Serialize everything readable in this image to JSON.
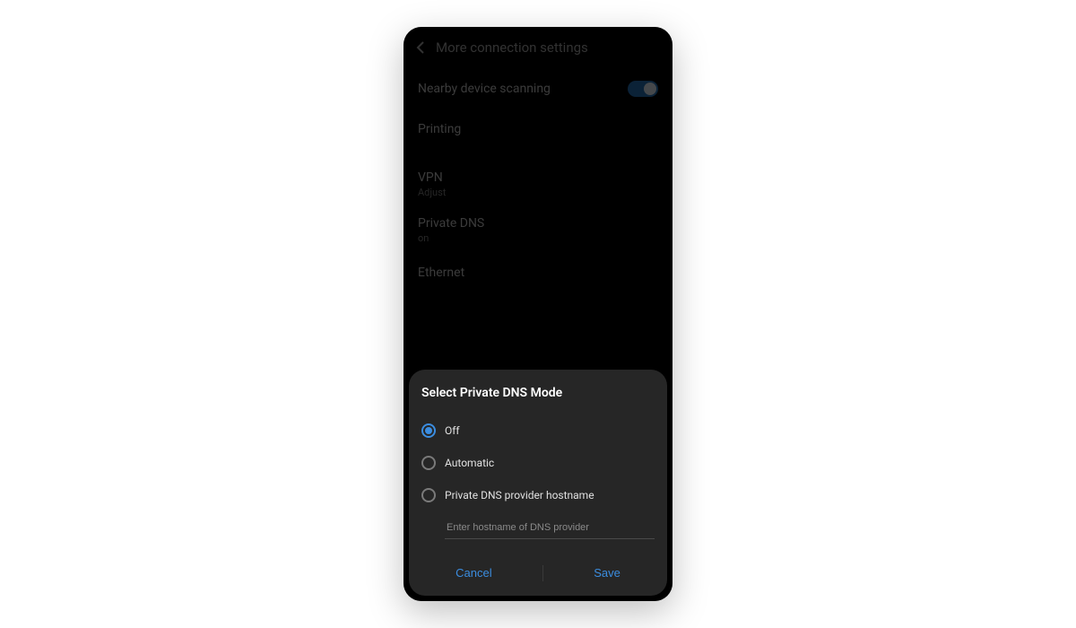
{
  "header": {
    "title": "More connection settings"
  },
  "settings": {
    "nearby_device_scanning": {
      "label": "Nearby device scanning"
    },
    "printing": {
      "label": "Printing"
    },
    "vpn": {
      "label": "VPN",
      "sub": "Adjust"
    },
    "private_dns": {
      "label": "Private DNS",
      "sub": "on"
    },
    "ethernet": {
      "label": "Ethernet"
    }
  },
  "dialog": {
    "title": "Select Private DNS Mode",
    "options": {
      "off": "Off",
      "automatic": "Automatic",
      "hostname": "Private DNS provider hostname"
    },
    "hostname_placeholder": "Enter hostname of DNS provider",
    "actions": {
      "cancel": "Cancel",
      "save": "Save"
    }
  }
}
